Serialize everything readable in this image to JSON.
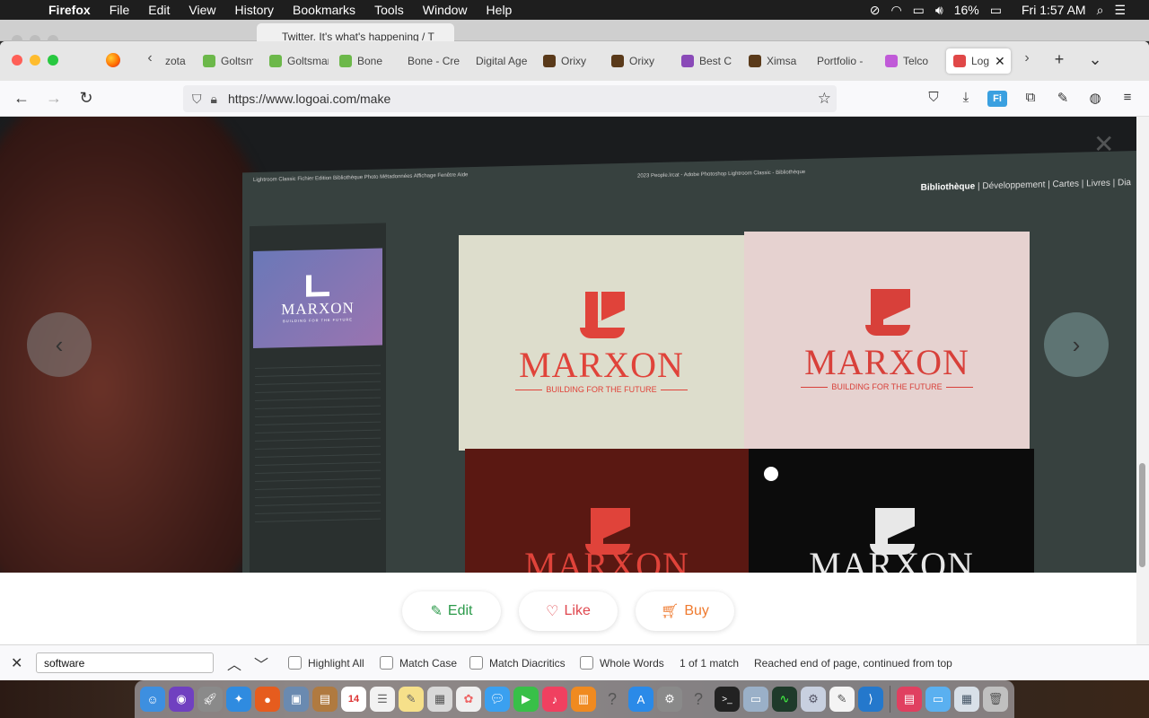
{
  "menubar": {
    "app_name": "Firefox",
    "items": [
      "File",
      "Edit",
      "View",
      "History",
      "Bookmarks",
      "Tools",
      "Window",
      "Help"
    ],
    "battery": "16%",
    "clock": "Fri 1:57 AM"
  },
  "background_window": {
    "tab_title": "Twitter. It's what's happening / T"
  },
  "tabs": [
    {
      "label": "zota",
      "color": "#999999"
    },
    {
      "label": "Goltsm",
      "color": "#6cb84a"
    },
    {
      "label": "Goltsman I",
      "color": "#6cb84a"
    },
    {
      "label": "Bone",
      "color": "#6cb84a"
    },
    {
      "label": "Bone - Cre",
      "color": "#cccccc"
    },
    {
      "label": "Digital Age",
      "color": "#cccccc"
    },
    {
      "label": "Orixy",
      "color": "#5a3a1a"
    },
    {
      "label": "Orixy",
      "color": "#5a3a1a"
    },
    {
      "label": "Best C",
      "color": "#8a4ab8"
    },
    {
      "label": "Ximsa",
      "color": "#5a3a1a"
    },
    {
      "label": "Portfolio -",
      "color": "#cccccc"
    },
    {
      "label": "Telco",
      "color": "#c05ad8"
    },
    {
      "label": "Log",
      "color": "#e04848",
      "active": true
    }
  ],
  "navbar": {
    "url": "https://www.logoai.com/make"
  },
  "hero": {
    "lightroom_menu": "Lightroom Classic  Fichier  Edition  Bibliothèque  Photo  Métadonnées  Affichage  Fenêtre  Aide",
    "lightroom_title": "2023 People.lrcat - Adobe Photoshop Lightroom Classic - Bibliothèque",
    "lightroom_nav_active": "Bibliothèque",
    "lightroom_nav_rest": " | Développement | Cartes | Livres | Dia",
    "logo_brand": "MARXON",
    "logo_tagline": "BUILDING FOR THE FUTURE",
    "thumb_tagline": "BUILDING FOR THE FUTURE",
    "colors": {
      "red": "#e0433a",
      "tile_cream": "#ddddcc",
      "tile_pink": "#e6d2d0",
      "tile_maroon": "#5a1812",
      "tile_black": "#0c0c0c"
    }
  },
  "actions": {
    "edit_label": "Edit",
    "like_label": "Like",
    "buy_label": "Buy"
  },
  "findbar": {
    "query": "software",
    "options": [
      "Highlight All",
      "Match Case",
      "Match Diacritics",
      "Whole Words"
    ],
    "match_count": "1 of 1 match",
    "status": "Reached end of page, continued from top"
  },
  "dock": {
    "calendar_day": "14"
  }
}
